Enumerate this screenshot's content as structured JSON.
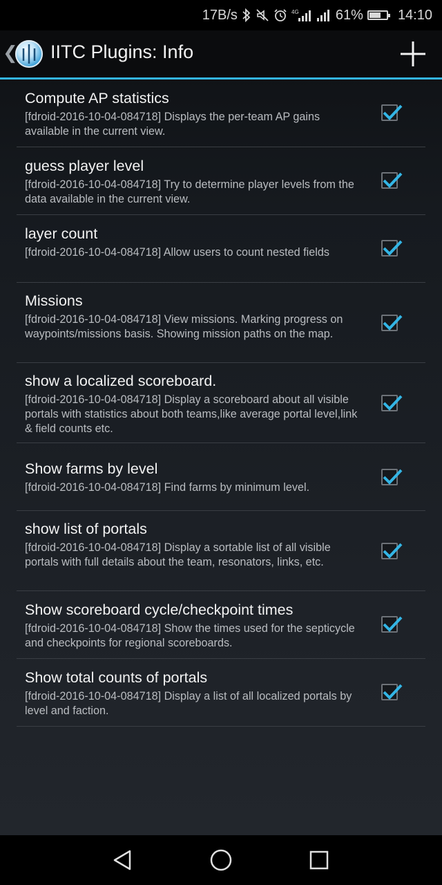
{
  "status_bar": {
    "network_speed": "17B/s",
    "battery_percent": "61%",
    "time": "14:10",
    "icons": [
      "bluetooth-icon",
      "mute-icon",
      "alarm-icon",
      "4g-signal-icon",
      "signal-icon",
      "battery-icon"
    ]
  },
  "action_bar": {
    "back_glyph": "❮",
    "title": "IITC Plugins: Info",
    "add_icon": "plus-icon"
  },
  "plugins": [
    {
      "title": "Compute AP statistics",
      "description": "[fdroid-2016-10-04-084718] Displays the per-team AP gains available in the current view.",
      "checked": true
    },
    {
      "title": "guess player level",
      "description": "[fdroid-2016-10-04-084718] Try to determine player levels from the data available in the current view.",
      "checked": true
    },
    {
      "title": "layer count",
      "description": "[fdroid-2016-10-04-084718] Allow users to count nested fields",
      "checked": true
    },
    {
      "title": "Missions",
      "description": "[fdroid-2016-10-04-084718] View missions. Marking progress on waypoints/missions basis. Showing mission paths on the map.",
      "checked": true
    },
    {
      "title": "show a localized scoreboard.",
      "description": "[fdroid-2016-10-04-084718] Display a scoreboard about all visible portals with statistics about both teams,like average portal level,link & field counts etc.",
      "checked": true
    },
    {
      "title": "Show farms by level",
      "description": "[fdroid-2016-10-04-084718] Find farms by minimum level.",
      "checked": true
    },
    {
      "title": "show list of portals",
      "description": "[fdroid-2016-10-04-084718] Display a sortable list of all visible portals with full details about the team, resonators, links, etc.",
      "checked": true
    },
    {
      "title": "Show scoreboard cycle/checkpoint times",
      "description": "[fdroid-2016-10-04-084718] Show the times used for the septicycle and checkpoints for regional scoreboards.",
      "checked": true
    },
    {
      "title": "Show total counts of portals",
      "description": "[fdroid-2016-10-04-084718] Display a list of all localized portals by level and faction.",
      "checked": true
    }
  ],
  "colors": {
    "accent": "#33b5e5",
    "background": "#1e2228",
    "text_primary": "#f2f2f2",
    "text_secondary": "#b9bcc0"
  },
  "nav_bar": {
    "icons": [
      "back-triangle-icon",
      "home-circle-icon",
      "recents-square-icon"
    ]
  }
}
